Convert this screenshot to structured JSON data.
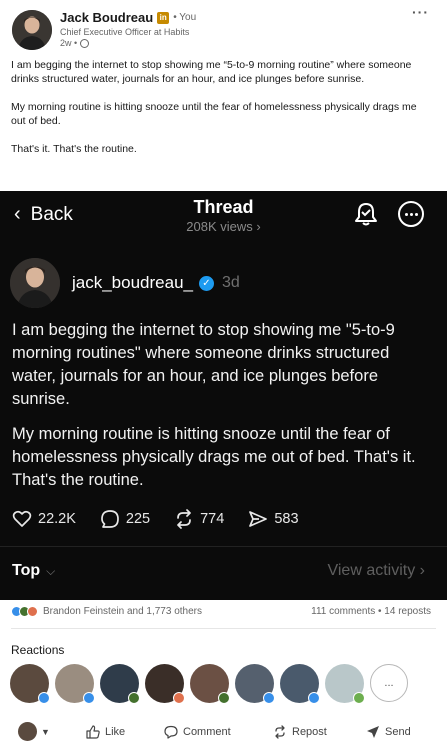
{
  "author": {
    "name": "Jack Boudreau",
    "badge": "in",
    "you_label": "• You",
    "headline": "Chief Executive Officer at Habits",
    "time": "2w •"
  },
  "post": {
    "paragraphs": [
      "I am begging the internet to stop showing me “5-to-9 morning routine” where someone drinks structured water, journals for an hour, and ice plunges before sunrise.",
      "My morning routine is hitting snooze until the fear of homelessness physically drags me out of bed.",
      "That's it. That's the routine."
    ]
  },
  "thread": {
    "back_label": "Back",
    "title": "Thread",
    "views": "208K views ›",
    "username": "jack_boudreau_",
    "age": "3d",
    "paragraphs": [
      "I am begging the internet to stop showing me \"5-to-9 morning routines\" where someone drinks structured water, journals for an hour, and ice plunges before sunrise.",
      "My morning routine is hitting snooze until the fear of homelessness physically drags me out of bed. That's it. That's the routine."
    ],
    "likes": "22.2K",
    "replies": "225",
    "reposts": "774",
    "shares": "583",
    "sort_label": "Top",
    "view_activity": "View activity ›"
  },
  "social": {
    "reactors_text": "Brandon Feinstein and 1,773 others",
    "comments_reposts": "111 comments • 14 reposts",
    "reactions_label": "Reactions",
    "more_label": "..."
  },
  "actions": {
    "like": "Like",
    "comment": "Comment",
    "repost": "Repost",
    "send": "Send"
  },
  "colors": {
    "linkedin_blue": "#0a66c2",
    "thread_bg": "#0b0b0b",
    "verified": "#1d9bf0"
  }
}
